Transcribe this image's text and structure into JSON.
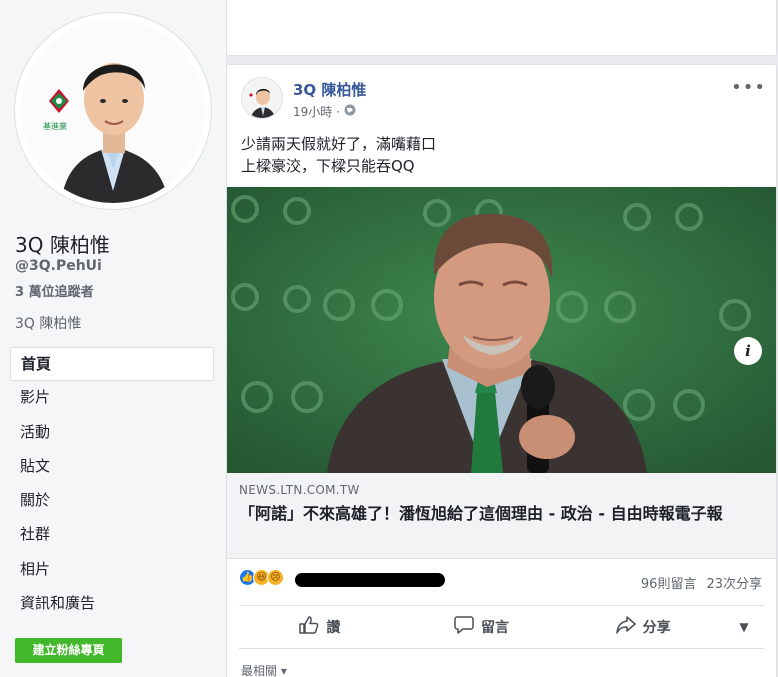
{
  "profile": {
    "name": "3Q 陳柏惟",
    "handle": "@3Q.PehUi",
    "followers": "3 萬位追蹤者",
    "subname": "3Q 陳柏惟",
    "party_logo_text": "基進黨"
  },
  "nav": {
    "items": [
      {
        "label": "首頁",
        "active": true
      },
      {
        "label": "影片"
      },
      {
        "label": "活動"
      },
      {
        "label": "貼文"
      },
      {
        "label": "關於"
      },
      {
        "label": "社群"
      },
      {
        "label": "相片"
      },
      {
        "label": "資訊和廣告"
      }
    ],
    "create_button": "建立粉絲專頁"
  },
  "post": {
    "author": "3Q 陳柏惟",
    "time": "19小時",
    "privacy_icon": "globe-icon",
    "more_icon": "more-icon",
    "text_lines": [
      "少請兩天假就好了，滿嘴藉口",
      "上樑豪洨，下樑只能吞QQ"
    ],
    "link": {
      "domain": "NEWS.LTN.COM.TW",
      "title": "「阿諾」不來高雄了！潘恆旭給了這個理由 - 政治 - 自由時報電子報"
    },
    "comments_count": "96則留言",
    "shares_count": "23次分享",
    "actions": {
      "like": "讚",
      "comment": "留言",
      "share": "分享"
    },
    "sort_label": "最相關"
  },
  "colors": {
    "accent": "#385898",
    "create_button": "#42b72a",
    "image_bg": "#2f6b3e"
  }
}
